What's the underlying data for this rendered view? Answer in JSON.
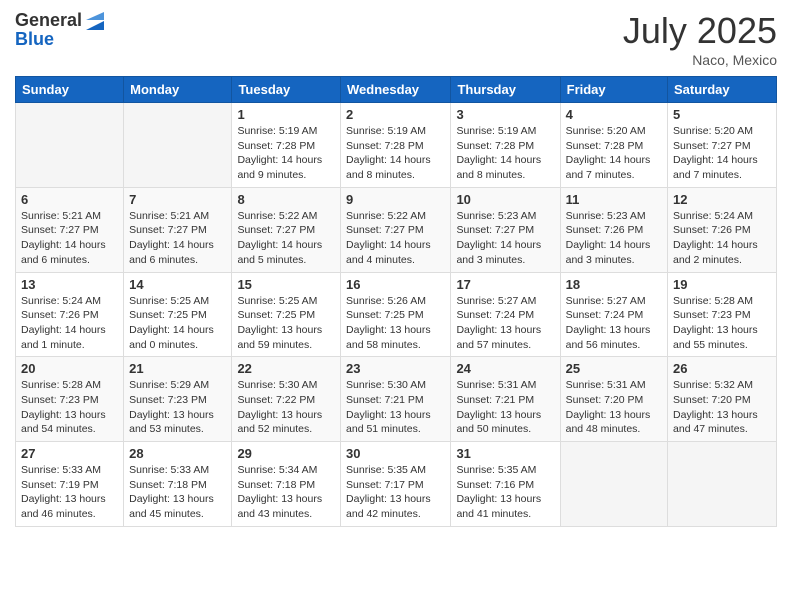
{
  "header": {
    "logo_general": "General",
    "logo_blue": "Blue",
    "title": "July 2025",
    "location": "Naco, Mexico"
  },
  "weekdays": [
    "Sunday",
    "Monday",
    "Tuesday",
    "Wednesday",
    "Thursday",
    "Friday",
    "Saturday"
  ],
  "weeks": [
    [
      null,
      null,
      {
        "day": "1",
        "sunrise": "5:19 AM",
        "sunset": "7:28 PM",
        "daylight": "14 hours and 9 minutes."
      },
      {
        "day": "2",
        "sunrise": "5:19 AM",
        "sunset": "7:28 PM",
        "daylight": "14 hours and 8 minutes."
      },
      {
        "day": "3",
        "sunrise": "5:19 AM",
        "sunset": "7:28 PM",
        "daylight": "14 hours and 8 minutes."
      },
      {
        "day": "4",
        "sunrise": "5:20 AM",
        "sunset": "7:28 PM",
        "daylight": "14 hours and 7 minutes."
      },
      {
        "day": "5",
        "sunrise": "5:20 AM",
        "sunset": "7:27 PM",
        "daylight": "14 hours and 7 minutes."
      }
    ],
    [
      {
        "day": "6",
        "sunrise": "5:21 AM",
        "sunset": "7:27 PM",
        "daylight": "14 hours and 6 minutes."
      },
      {
        "day": "7",
        "sunrise": "5:21 AM",
        "sunset": "7:27 PM",
        "daylight": "14 hours and 6 minutes."
      },
      {
        "day": "8",
        "sunrise": "5:22 AM",
        "sunset": "7:27 PM",
        "daylight": "14 hours and 5 minutes."
      },
      {
        "day": "9",
        "sunrise": "5:22 AM",
        "sunset": "7:27 PM",
        "daylight": "14 hours and 4 minutes."
      },
      {
        "day": "10",
        "sunrise": "5:23 AM",
        "sunset": "7:27 PM",
        "daylight": "14 hours and 3 minutes."
      },
      {
        "day": "11",
        "sunrise": "5:23 AM",
        "sunset": "7:26 PM",
        "daylight": "14 hours and 3 minutes."
      },
      {
        "day": "12",
        "sunrise": "5:24 AM",
        "sunset": "7:26 PM",
        "daylight": "14 hours and 2 minutes."
      }
    ],
    [
      {
        "day": "13",
        "sunrise": "5:24 AM",
        "sunset": "7:26 PM",
        "daylight": "14 hours and 1 minute."
      },
      {
        "day": "14",
        "sunrise": "5:25 AM",
        "sunset": "7:25 PM",
        "daylight": "14 hours and 0 minutes."
      },
      {
        "day": "15",
        "sunrise": "5:25 AM",
        "sunset": "7:25 PM",
        "daylight": "13 hours and 59 minutes."
      },
      {
        "day": "16",
        "sunrise": "5:26 AM",
        "sunset": "7:25 PM",
        "daylight": "13 hours and 58 minutes."
      },
      {
        "day": "17",
        "sunrise": "5:27 AM",
        "sunset": "7:24 PM",
        "daylight": "13 hours and 57 minutes."
      },
      {
        "day": "18",
        "sunrise": "5:27 AM",
        "sunset": "7:24 PM",
        "daylight": "13 hours and 56 minutes."
      },
      {
        "day": "19",
        "sunrise": "5:28 AM",
        "sunset": "7:23 PM",
        "daylight": "13 hours and 55 minutes."
      }
    ],
    [
      {
        "day": "20",
        "sunrise": "5:28 AM",
        "sunset": "7:23 PM",
        "daylight": "13 hours and 54 minutes."
      },
      {
        "day": "21",
        "sunrise": "5:29 AM",
        "sunset": "7:23 PM",
        "daylight": "13 hours and 53 minutes."
      },
      {
        "day": "22",
        "sunrise": "5:30 AM",
        "sunset": "7:22 PM",
        "daylight": "13 hours and 52 minutes."
      },
      {
        "day": "23",
        "sunrise": "5:30 AM",
        "sunset": "7:21 PM",
        "daylight": "13 hours and 51 minutes."
      },
      {
        "day": "24",
        "sunrise": "5:31 AM",
        "sunset": "7:21 PM",
        "daylight": "13 hours and 50 minutes."
      },
      {
        "day": "25",
        "sunrise": "5:31 AM",
        "sunset": "7:20 PM",
        "daylight": "13 hours and 48 minutes."
      },
      {
        "day": "26",
        "sunrise": "5:32 AM",
        "sunset": "7:20 PM",
        "daylight": "13 hours and 47 minutes."
      }
    ],
    [
      {
        "day": "27",
        "sunrise": "5:33 AM",
        "sunset": "7:19 PM",
        "daylight": "13 hours and 46 minutes."
      },
      {
        "day": "28",
        "sunrise": "5:33 AM",
        "sunset": "7:18 PM",
        "daylight": "13 hours and 45 minutes."
      },
      {
        "day": "29",
        "sunrise": "5:34 AM",
        "sunset": "7:18 PM",
        "daylight": "13 hours and 43 minutes."
      },
      {
        "day": "30",
        "sunrise": "5:35 AM",
        "sunset": "7:17 PM",
        "daylight": "13 hours and 42 minutes."
      },
      {
        "day": "31",
        "sunrise": "5:35 AM",
        "sunset": "7:16 PM",
        "daylight": "13 hours and 41 minutes."
      },
      null,
      null
    ]
  ],
  "labels": {
    "sunrise": "Sunrise:",
    "sunset": "Sunset:",
    "daylight": "Daylight:"
  }
}
